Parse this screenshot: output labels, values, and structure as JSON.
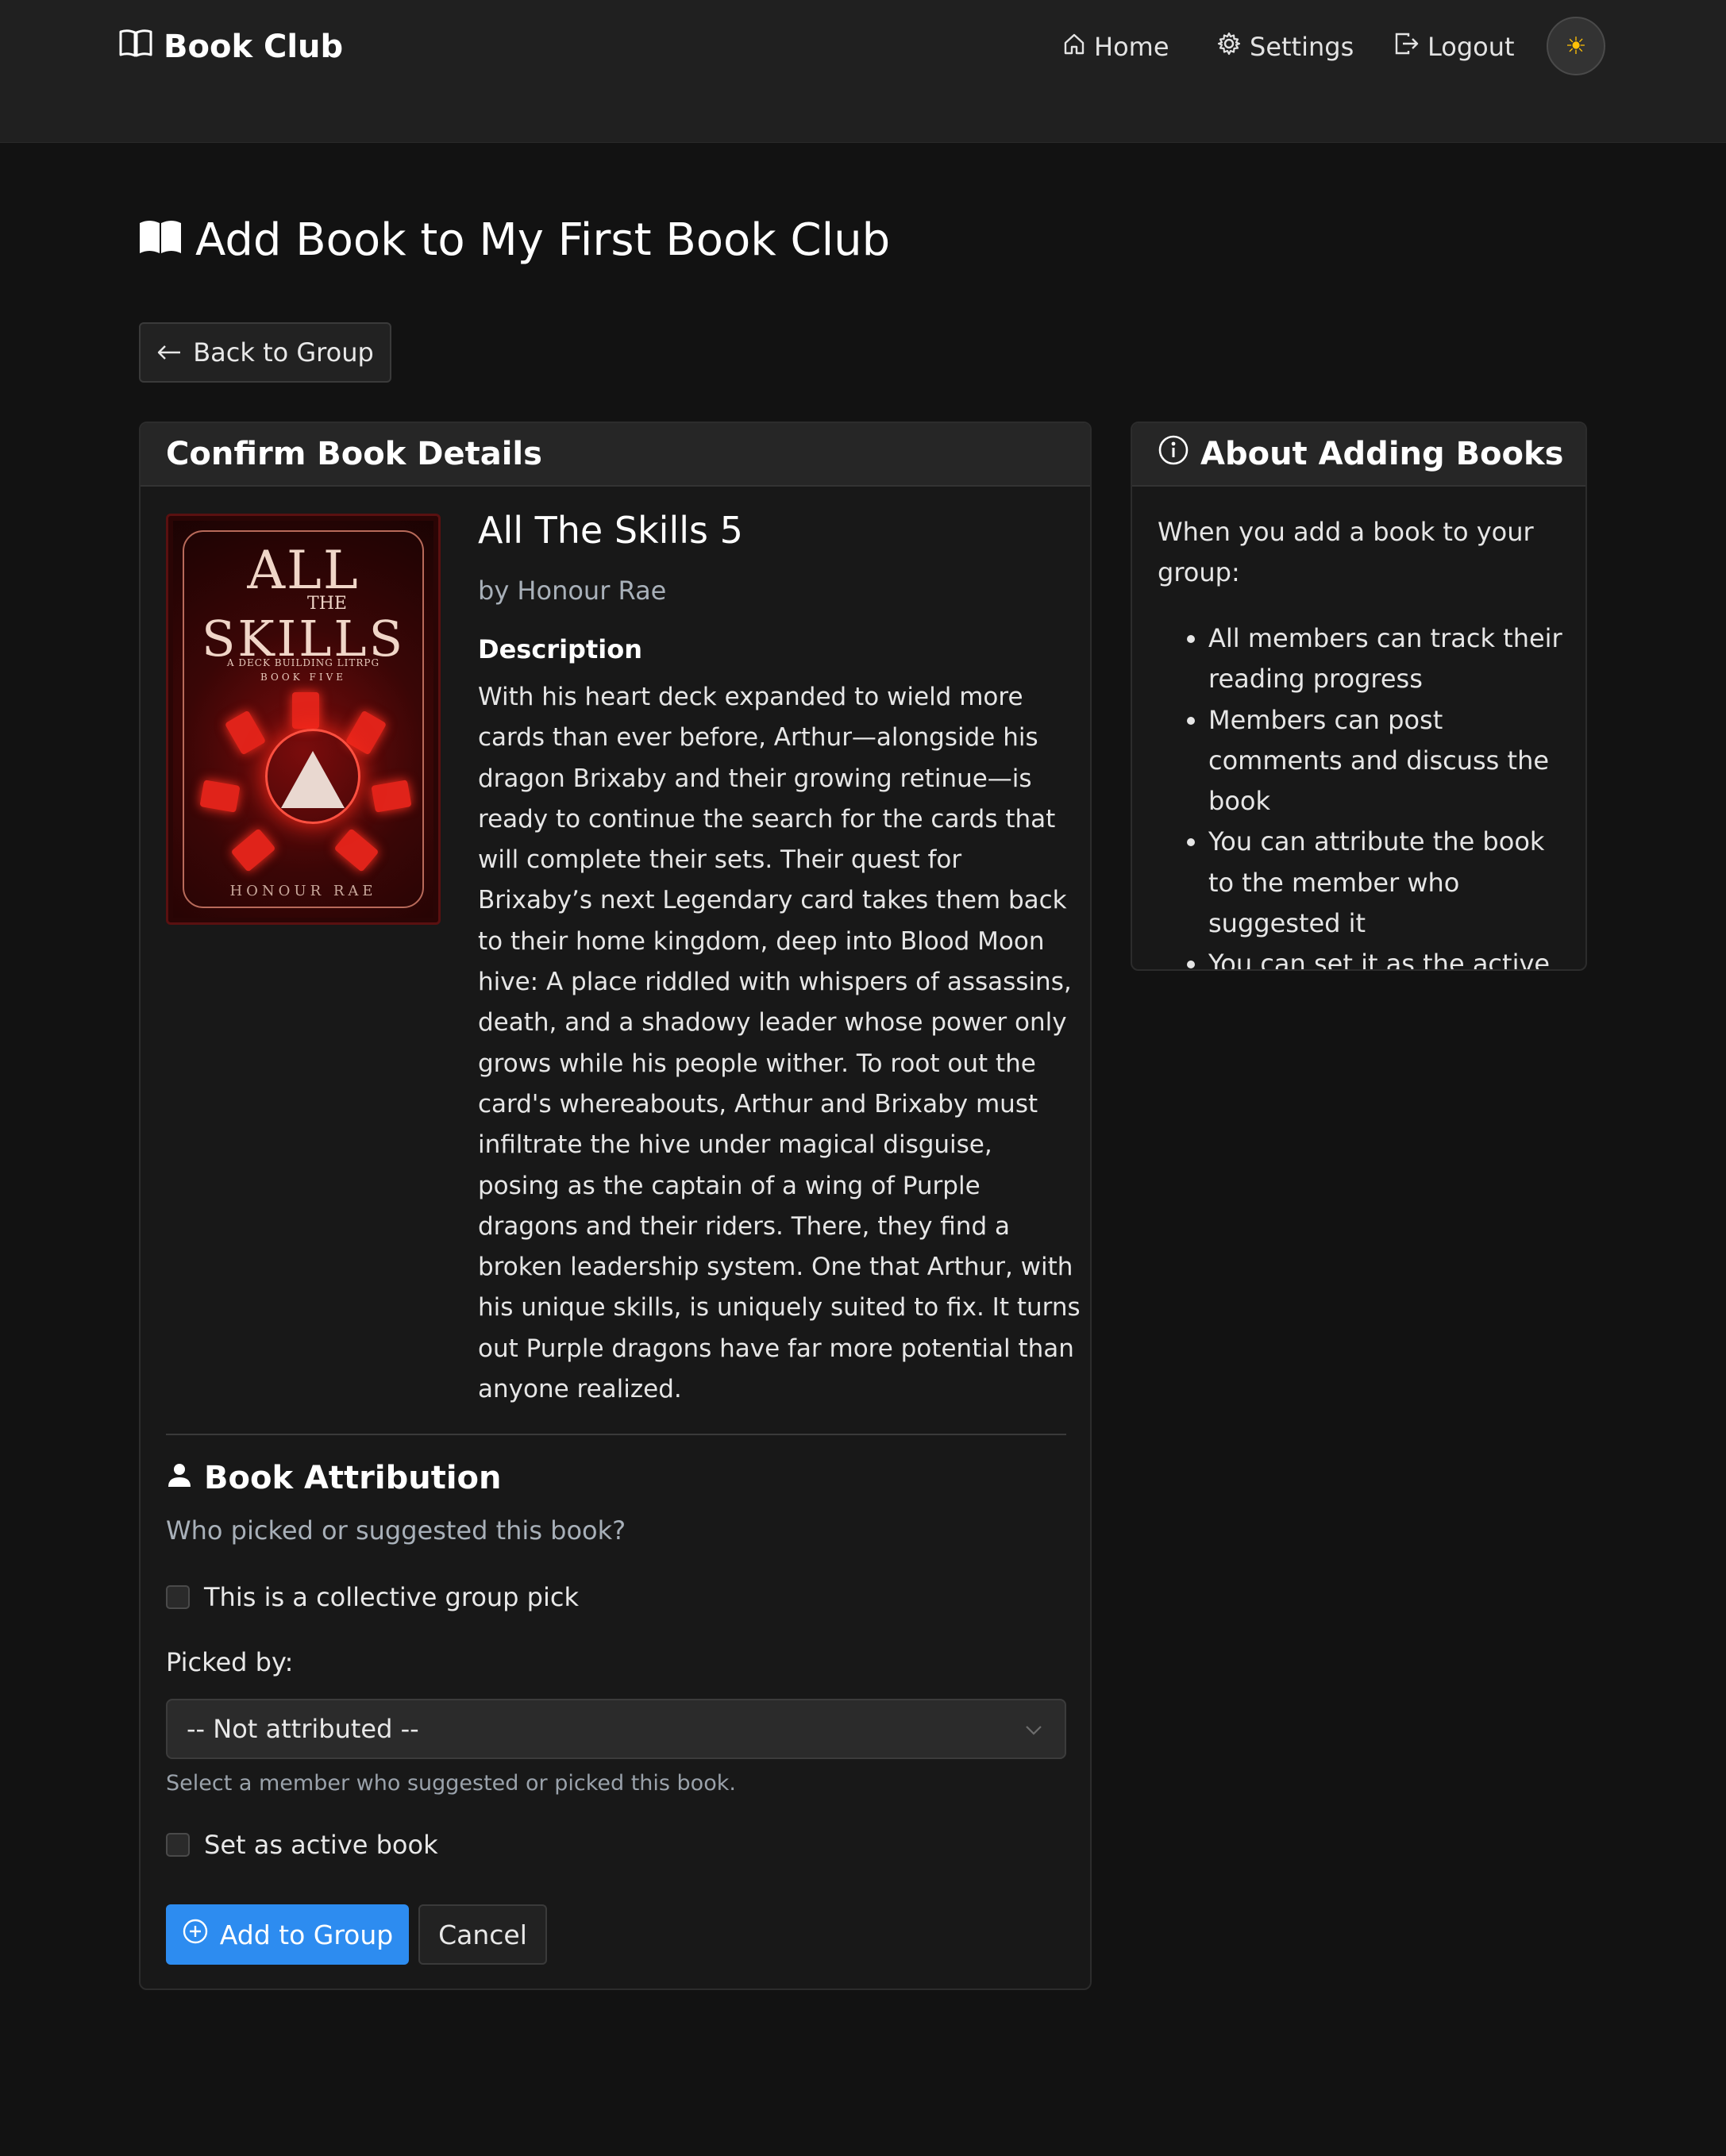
{
  "nav": {
    "brand": "Book Club",
    "home": "Home",
    "settings": "Settings",
    "logout": "Logout",
    "theme_icon": "sun-icon"
  },
  "page": {
    "title": "Add Book to My First Book Club",
    "back_label": "Back to Group"
  },
  "confirm_card": {
    "header": "Confirm Book Details",
    "book": {
      "title": "All The Skills 5",
      "author": "by Honour Rae",
      "cover": {
        "line1": "ALL",
        "line2": "THE",
        "line3": "SKILLS",
        "subtitle": "A DECK BUILDING LITRPG",
        "book_no": "BOOK FIVE",
        "author": "HONOUR RAE"
      },
      "description_heading": "Description",
      "description": "With his heart deck expanded to wield more cards than ever before, Arthur—alongside his dragon Brixaby and their growing retinue—is ready to continue the search for the cards that will complete their sets. Their quest for Brixaby’s next Legendary card takes them back to their home kingdom, deep into Blood Moon hive: A place riddled with whispers of assassins, death, and a shadowy leader whose power only grows while his people wither. To root out the card's whereabouts, Arthur and Brixaby must infiltrate the hive under magical disguise, posing as the captain of a wing of Purple dragons and their riders. There, they find a broken leadership system. One that Arthur, with his unique skills, is uniquely suited to fix. It turns out Purple dragons have far more potential than anyone realized."
    },
    "attribution": {
      "heading": "Book Attribution",
      "subheading": "Who picked or suggested this book?",
      "collective_label": "This is a collective group pick",
      "collective_checked": false,
      "picked_by_label": "Picked by:",
      "picked_by_value": "-- Not attributed --",
      "help_text": "Select a member who suggested or picked this book.",
      "active_label": "Set as active book",
      "active_checked": false
    },
    "add_label": "Add to Group",
    "cancel_label": "Cancel"
  },
  "side_card": {
    "header": "About Adding Books",
    "intro": "When you add a book to your group:",
    "items": [
      "All members can track their reading progress",
      "Members can post comments and discuss the book",
      "You can attribute the book to the member who suggested it",
      "You can set it as the active book for the group"
    ]
  },
  "colors": {
    "background": "#121212",
    "navbar": "#202020",
    "card": "#181818",
    "primary": "#2d8cf0",
    "theme_icon": "#ffc107"
  }
}
